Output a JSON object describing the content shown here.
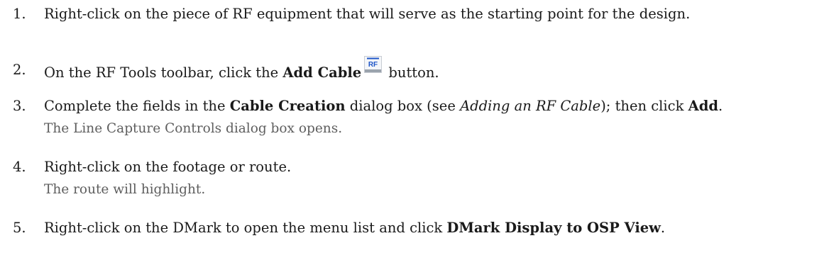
{
  "steps": [
    {
      "number": "1.",
      "text": "Right-click on the piece of RF equipment that will serve as the starting point for the design."
    },
    {
      "number": "2.",
      "text_before": "On the RF Tools toolbar, click the ",
      "bold": "Add Cable",
      "icon_label": "RF",
      "icon": "rf-add-cable-icon",
      "text_after": " button."
    },
    {
      "number": "3.",
      "text_1": "Complete the fields in the ",
      "bold_1": "Cable Creation",
      "text_2": " dialog box (see ",
      "italic": "Adding an RF Cable",
      "text_3": "); then click ",
      "bold_2": "Add",
      "text_4": ".",
      "note": "The Line Capture Controls dialog box opens."
    },
    {
      "number": "4.",
      "text": "Right-click on the footage or route.",
      "note": "The route will highlight."
    },
    {
      "number": "5.",
      "text_before": "Right-click on the DMark to open the menu list and click ",
      "bold": "DMark Display to OSP View",
      "text_after": "."
    }
  ]
}
